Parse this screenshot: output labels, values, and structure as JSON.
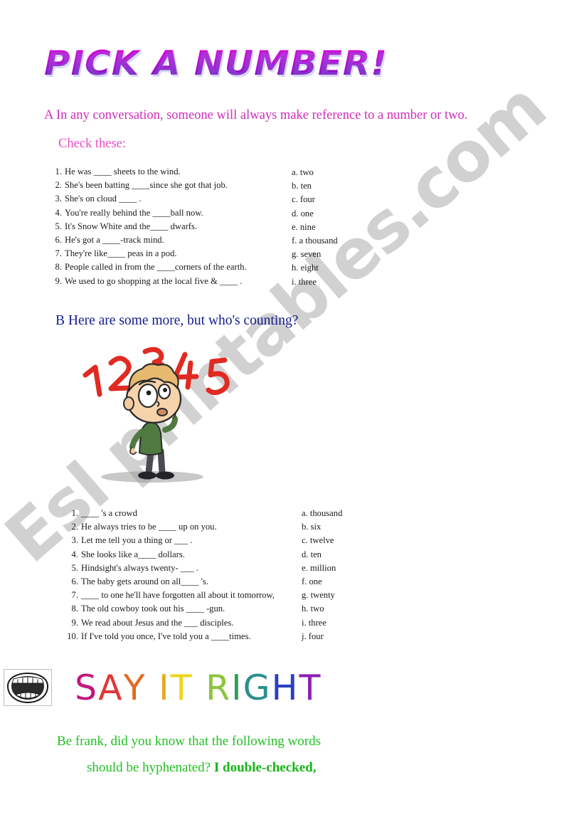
{
  "title": "PICK A NUMBER!",
  "watermark": "Esl printables.com",
  "section_a": {
    "letter_intro": "A  In any conversation, someone will always make reference to a number or two.",
    "check": "Check these:",
    "items": [
      {
        "num": "1.",
        "text": "He was ____ sheets to the wind."
      },
      {
        "num": "2.",
        "text": "She's been batting ____since she got that job."
      },
      {
        "num": "3.",
        "text": "She's on cloud ____ ."
      },
      {
        "num": "4.",
        "text": "You're really behind the ____ball now."
      },
      {
        "num": "5.",
        "text": "It's Snow White and the____ dwarfs."
      },
      {
        "num": "6.",
        "text": "He's got a ____-track mind."
      },
      {
        "num": "7.",
        "text": "They're like____ peas in a pod."
      },
      {
        "num": "8.",
        "text": "People called in from the ____corners of the earth."
      },
      {
        "num": "9.",
        "text": "We used to go shopping at the local five & ____ ."
      }
    ],
    "options": [
      "a. two",
      "b. ten",
      "c. four",
      "d. one",
      "e. nine",
      "f. a thousand",
      "g. seven",
      "h. eight",
      "i. three"
    ]
  },
  "section_b": {
    "heading": "B Here are some more, but who's counting?",
    "illustration_numbers": [
      "1",
      "2",
      "3",
      "4",
      "5"
    ],
    "items": [
      {
        "num": "1.",
        "text": "____ 's a crowd"
      },
      {
        "num": "2.",
        "text": "He always tries to be ____ up on you."
      },
      {
        "num": "3.",
        "text": "Let me tell you a thing or  ___ ."
      },
      {
        "num": "4.",
        "text": "She looks like a____ dollars."
      },
      {
        "num": "5.",
        "text": "Hindsight's always twenty-  ___ ."
      },
      {
        "num": "6.",
        "text": "The baby gets around on all____ 's."
      },
      {
        "num": "7.",
        "text": "____ to one he'll have forgotten all about it tomorrow,"
      },
      {
        "num": "8.",
        "text": "The old cowboy took out his ____ -gun."
      },
      {
        "num": "9.",
        "text": "We read about Jesus and the ___ disciples."
      },
      {
        "num": "10.",
        "text": "If I've told you once, I've told you a ____times."
      }
    ],
    "options": [
      "a. thousand",
      "b. six",
      "c. twelve",
      "d. ten",
      "e. million",
      "f. one",
      "g. twenty",
      "h. two",
      "i. three",
      "j. four"
    ]
  },
  "say_it_right": {
    "letters": [
      {
        "char": "S",
        "color": "#c2187e"
      },
      {
        "char": "A",
        "color": "#e03838"
      },
      {
        "char": "Y",
        "color": "#e36a22"
      },
      {
        "char": " ",
        "color": "#ffffff"
      },
      {
        "char": "I",
        "color": "#e9a81e"
      },
      {
        "char": "T",
        "color": "#eed520"
      },
      {
        "char": " ",
        "color": "#ffffff"
      },
      {
        "char": "R",
        "color": "#8cc43c"
      },
      {
        "char": "I",
        "color": "#2e9e5b"
      },
      {
        "char": "G",
        "color": "#2a8f8f"
      },
      {
        "char": "H",
        "color": "#2a3fc0"
      },
      {
        "char": "T",
        "color": "#8b1fb5"
      }
    ],
    "line1": "Be frank, did you know that the following words",
    "line2_plain": "should be hyphenated? ",
    "line2_bold": "I double-checked,"
  }
}
